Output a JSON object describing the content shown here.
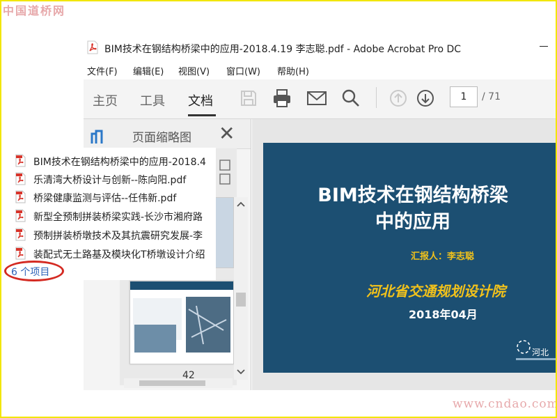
{
  "watermarks": {
    "top": "中国道桥网",
    "bottom": "www.cndao.com"
  },
  "window": {
    "title": "BIM技术在钢结构桥梁中的应用-2018.4.19  李志聪.pdf - Adobe Acrobat Pro DC"
  },
  "menu": {
    "items": [
      {
        "label": "文件(F)"
      },
      {
        "label": "编辑(E)"
      },
      {
        "label": "视图(V)"
      },
      {
        "label": "窗口(W)"
      },
      {
        "label": "帮助(H)"
      }
    ]
  },
  "toolbar": {
    "tabs": [
      {
        "label": "主页"
      },
      {
        "label": "工具"
      },
      {
        "label": "文档",
        "active": true
      }
    ],
    "icons": [
      "save-icon",
      "print-icon",
      "email-icon",
      "search-icon",
      "page-up-icon",
      "page-down-icon"
    ],
    "page_current": "1",
    "page_total": "/ 71"
  },
  "left_pane": {
    "title": "页面缩略图",
    "thumbnail_page_number": "42"
  },
  "slide": {
    "title_line1": "BIM技术在钢结构桥梁",
    "title_line2": "中的应用",
    "reporter": "汇报人：李志聪",
    "institute": "河北省交通规划设计院",
    "date": "2018年04月",
    "logo_text": "河北"
  },
  "file_list": {
    "items": [
      {
        "label": "BIM技术在钢结构桥梁中的应用-2018.4"
      },
      {
        "label": "乐清湾大桥设计与创新--陈向阳.pdf"
      },
      {
        "label": "桥梁健康监测与评估--任伟新.pdf"
      },
      {
        "label": "新型全预制拼装桥梁实践-长沙市湘府路"
      },
      {
        "label": "预制拼装桥墩技术及其抗震研究发展-李"
      },
      {
        "label": "装配式无土路基及模块化T桥墩设计介绍"
      }
    ],
    "count_text": "6 个项目"
  },
  "colors": {
    "frame": "#f2e600",
    "slide_bg": "#1c4f72",
    "slide_accent": "#f2c21b",
    "highlight_circle": "#d42a22",
    "count_link": "#2e63b8"
  }
}
